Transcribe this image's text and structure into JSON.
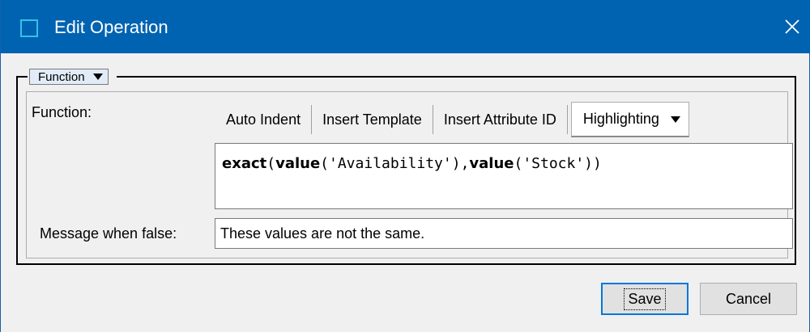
{
  "window": {
    "title": "Edit Operation",
    "icons": {
      "app": "window-icon",
      "close": "close-icon"
    }
  },
  "group": {
    "mode_selected": "Function"
  },
  "form": {
    "function_label": "Function:",
    "message_label": "Message when false:",
    "message_value": "These values are not the same."
  },
  "toolbar": {
    "auto_indent": "Auto Indent",
    "insert_template": "Insert Template",
    "insert_attribute_id": "Insert Attribute ID",
    "highlighting": "Highlighting"
  },
  "code": {
    "fn1": "exact",
    "fn2": "value",
    "arg1": "('Availability'),",
    "fn3": "value",
    "arg2": "('Stock'))",
    "open": "("
  },
  "buttons": {
    "save": "Save",
    "cancel": "Cancel"
  },
  "colors": {
    "titlebar": "#0063b1",
    "accent": "#0078d7"
  }
}
